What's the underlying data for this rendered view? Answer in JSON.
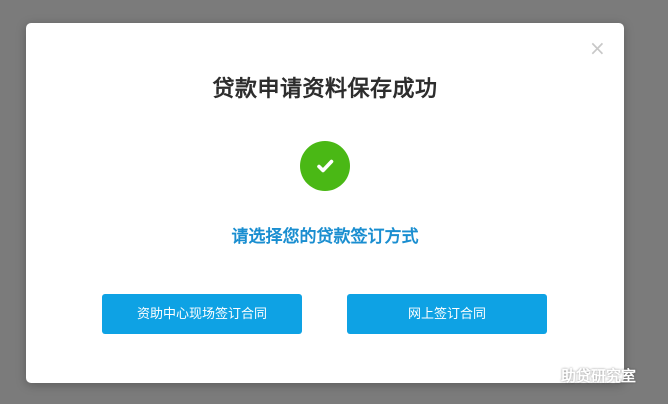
{
  "dialog": {
    "title": "贷款申请资料保存成功",
    "close_label": "×",
    "status_icon": "success-check-icon",
    "subtitle": "请选择您的贷款签订方式",
    "buttons": [
      {
        "label": "资助中心现场签订合同"
      },
      {
        "label": "网上签订合同"
      }
    ]
  },
  "watermark": {
    "text": "助贷研究室",
    "icon": "wechat-icon"
  },
  "colors": {
    "backdrop": "#7b7b7b",
    "success": "#4ab815",
    "accent_text": "#1a8ed0",
    "button": "#0ea2e4"
  }
}
